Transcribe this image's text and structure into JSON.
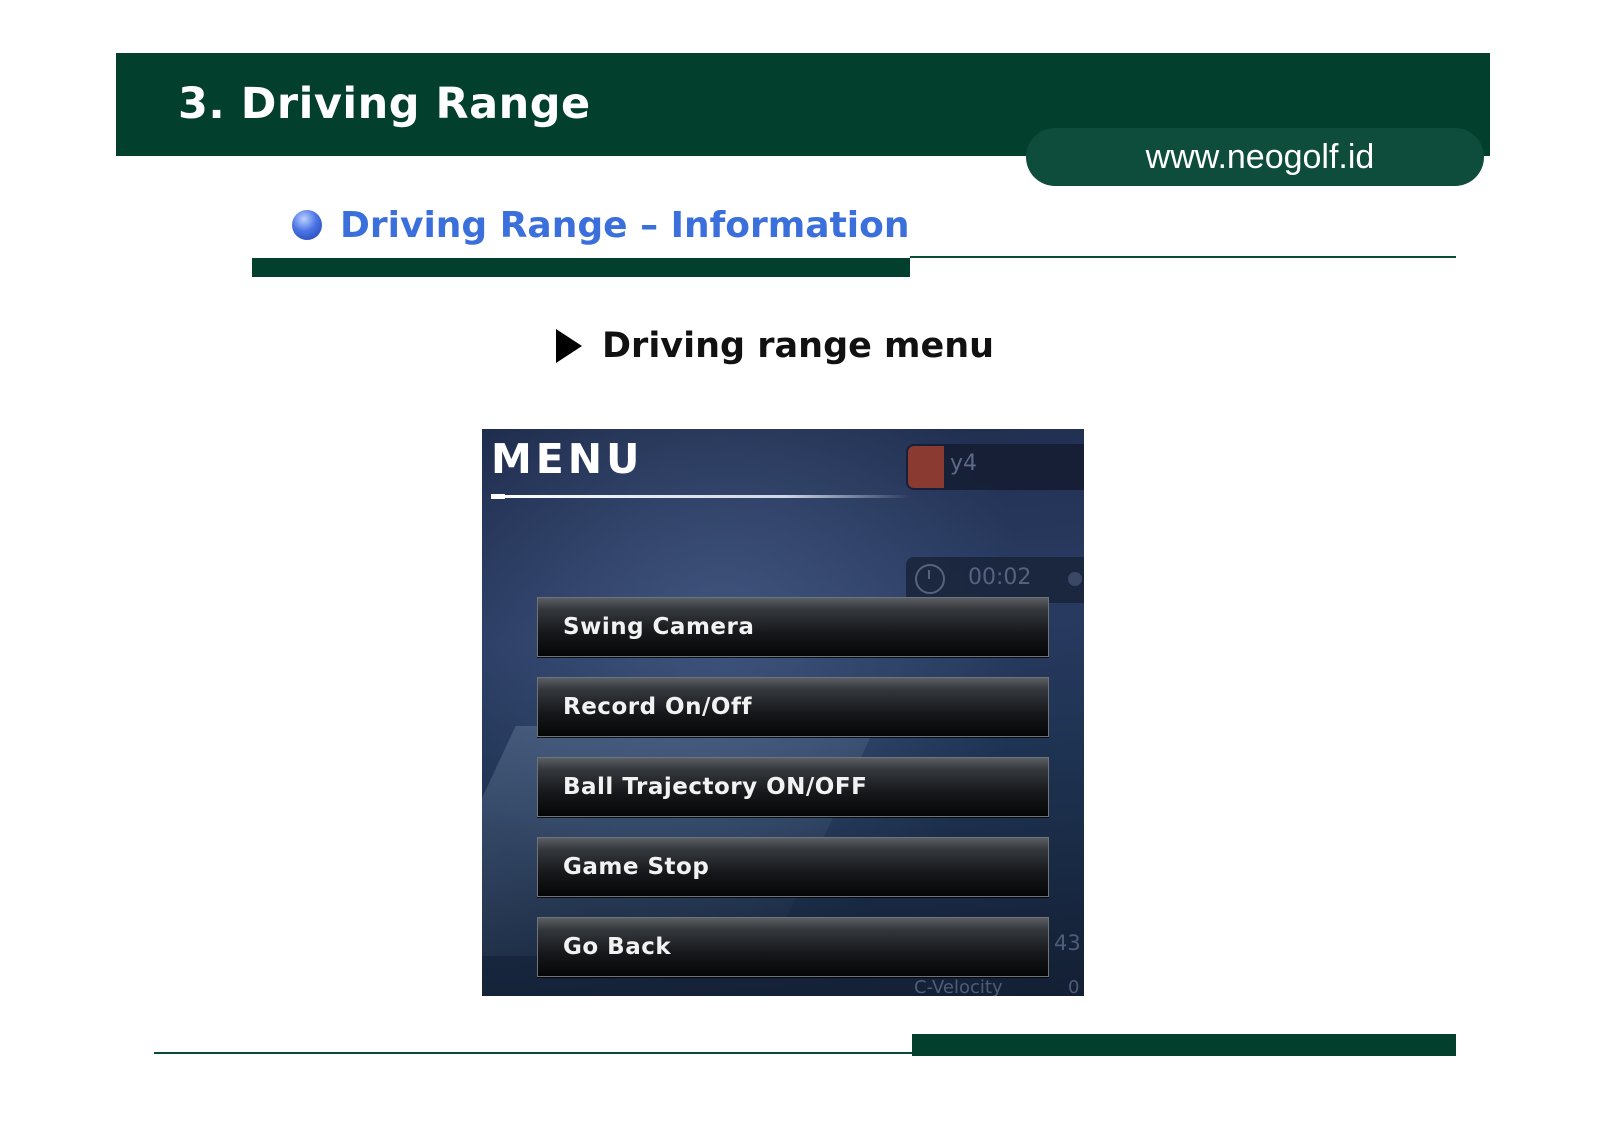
{
  "header": {
    "title": "3. Driving Range",
    "url": "www.neogolf.id"
  },
  "section": {
    "title": "Driving Range – Information"
  },
  "subheading": "Driving range menu",
  "game_screen": {
    "menu_title": "MENU",
    "hud": {
      "player": "y4",
      "time": "00:02",
      "partial_value": "43",
      "velocity_label": "C-Velocity",
      "velocity_value": "0"
    },
    "menu_items": [
      "Swing Camera",
      "Record On/Off",
      "Ball Trajectory ON/OFF",
      "Game Stop",
      "Go Back"
    ]
  },
  "colors": {
    "brand_green": "#023f2d",
    "section_blue": "#3a6fdc"
  }
}
